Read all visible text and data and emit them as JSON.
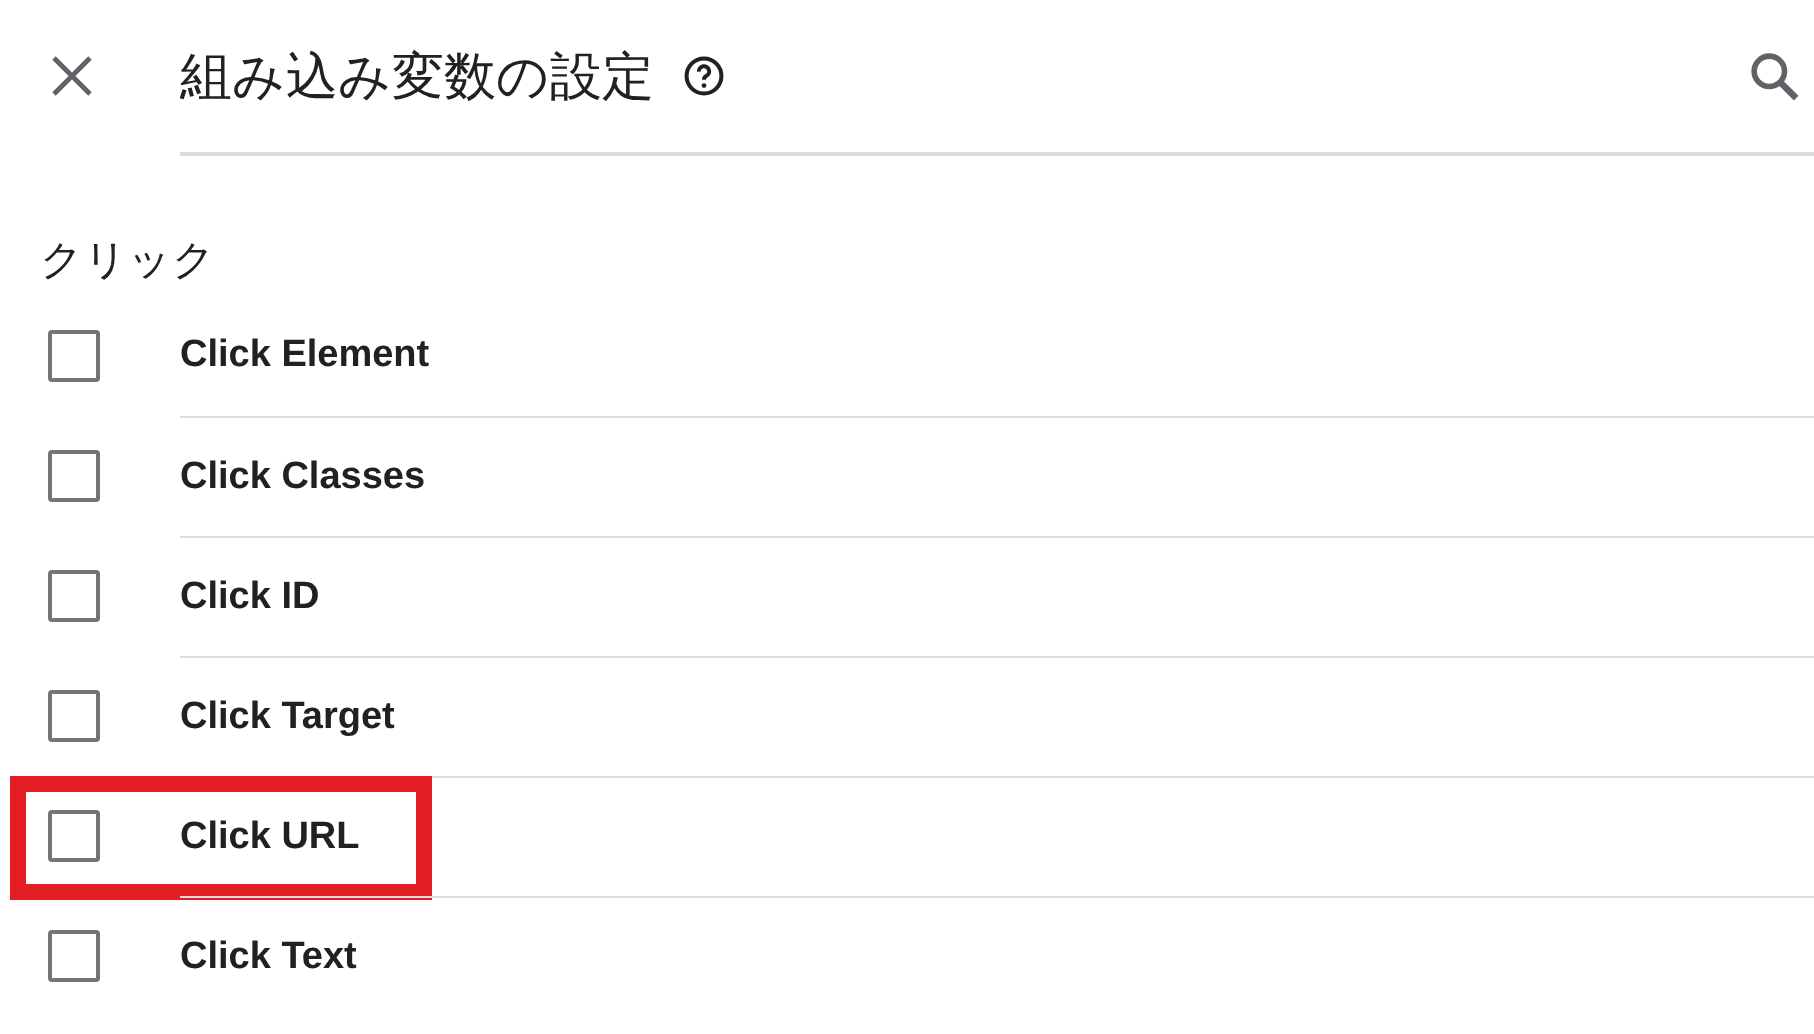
{
  "header": {
    "title": "組み込み変数の設定"
  },
  "section": {
    "label": "クリック"
  },
  "items": [
    {
      "label": "Click Element",
      "checked": false,
      "highlighted": false
    },
    {
      "label": "Click Classes",
      "checked": false,
      "highlighted": false
    },
    {
      "label": "Click ID",
      "checked": false,
      "highlighted": false
    },
    {
      "label": "Click Target",
      "checked": false,
      "highlighted": false
    },
    {
      "label": "Click URL",
      "checked": false,
      "highlighted": true
    },
    {
      "label": "Click Text",
      "checked": false,
      "highlighted": false
    }
  ]
}
